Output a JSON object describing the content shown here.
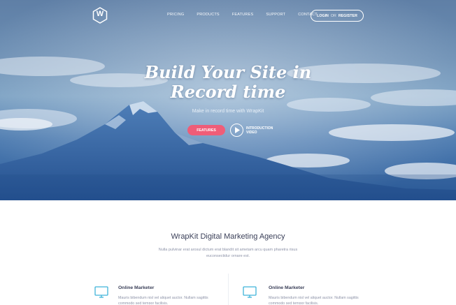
{
  "brand": {
    "logo_letter": "W",
    "logo_icon": "hexagon-w-logo-icon"
  },
  "nav": {
    "items": [
      {
        "label": "PRICING"
      },
      {
        "label": "PRODUCTS"
      },
      {
        "label": "FEATURES"
      },
      {
        "label": "SUPPORT"
      },
      {
        "label": "CONTACT"
      }
    ],
    "login_label": "LOGIN",
    "separator": "OR",
    "register_label": "REGISTER"
  },
  "hero": {
    "title_line1": "Build Your Site in",
    "title_line2": "Record time",
    "subtitle": "Make in record time with WrapKit",
    "features_button": "FEATURES",
    "video_label_line1": "INTRODUCTION",
    "video_label_line2": "VIDEO",
    "play_icon": "play-icon",
    "background": "mountain-clouds-photo"
  },
  "section": {
    "title": "WrapKit Digital Marketing Agency",
    "description": "Nulla pulvinar erat arosul dictum erat blandit sit ametam arcu quam pharetra risus euconsectidur ornare est."
  },
  "features": [
    {
      "icon": "monitor-icon",
      "title": "Online Marketer",
      "text": "Mauris bibendum nisl vel aliquet auctor. Nullam sagittis commodo sed tempor facilisis."
    },
    {
      "icon": "monitor-icon",
      "title": "Online Marketer",
      "text": "Mauris bibendum nisl vel aliquet auctor. Nullam sagittis commodo sed tempor facilisis."
    }
  ],
  "colors": {
    "accent_pink": "#ef5d78",
    "icon_blue": "#3fb3d9",
    "heading": "#3a3f58",
    "muted_text": "#8d93a8"
  }
}
